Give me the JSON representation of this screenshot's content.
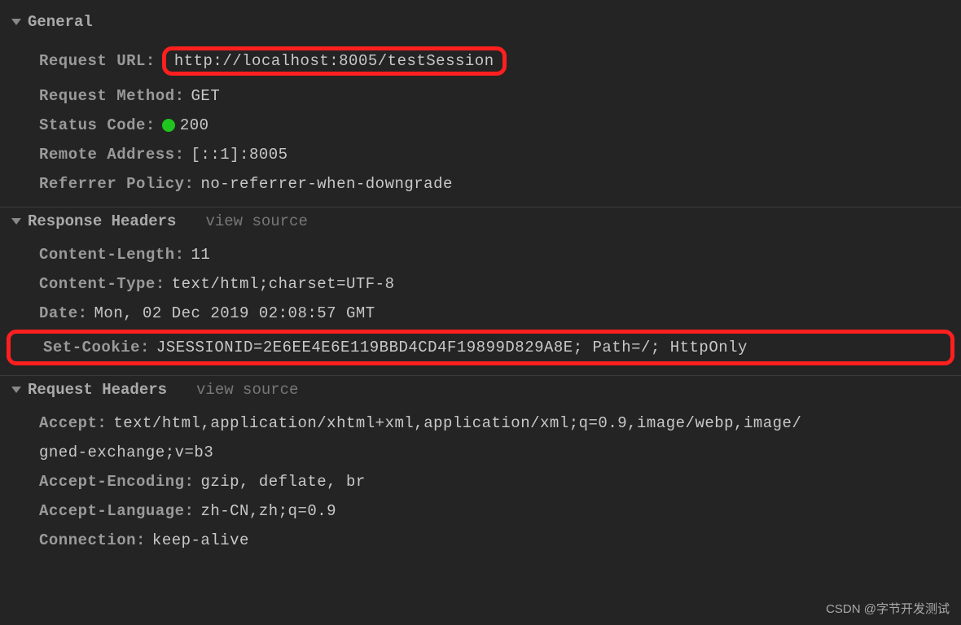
{
  "sections": {
    "general": {
      "title": "General",
      "request_url_label": "Request URL:",
      "request_url_value": "http://localhost:8005/testSession",
      "request_method_label": "Request Method:",
      "request_method_value": "GET",
      "status_code_label": "Status Code:",
      "status_code_value": "200",
      "remote_address_label": "Remote Address:",
      "remote_address_value": "[::1]:8005",
      "referrer_policy_label": "Referrer Policy:",
      "referrer_policy_value": "no-referrer-when-downgrade"
    },
    "response_headers": {
      "title": "Response Headers",
      "view_source": "view source",
      "content_length_label": "Content-Length:",
      "content_length_value": "11",
      "content_type_label": "Content-Type:",
      "content_type_value": "text/html;charset=UTF-8",
      "date_label": "Date:",
      "date_value": "Mon, 02 Dec 2019 02:08:57 GMT",
      "set_cookie_label": "Set-Cookie:",
      "set_cookie_value": "JSESSIONID=2E6EE4E6E119BBD4CD4F19899D829A8E; Path=/; HttpOnly"
    },
    "request_headers": {
      "title": "Request Headers",
      "view_source": "view source",
      "accept_label": "Accept:",
      "accept_value": "text/html,application/xhtml+xml,application/xml;q=0.9,image/webp,image/",
      "accept_value_cont": "gned-exchange;v=b3",
      "accept_encoding_label": "Accept-Encoding:",
      "accept_encoding_value": "gzip, deflate, br",
      "accept_language_label": "Accept-Language:",
      "accept_language_value": "zh-CN,zh;q=0.9",
      "connection_label": "Connection:",
      "connection_value": "keep-alive"
    }
  },
  "watermark": "CSDN @字节开发测试"
}
